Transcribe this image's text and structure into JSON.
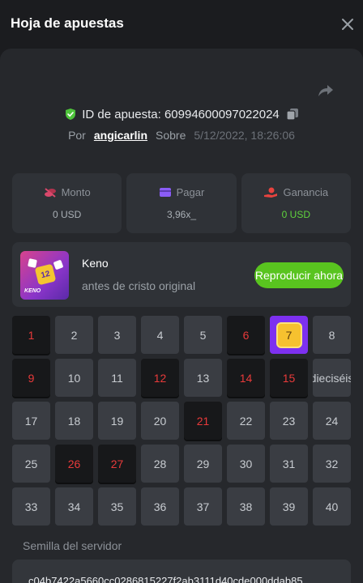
{
  "header": {
    "title": "Hoja de apuestas"
  },
  "bet": {
    "id_label": "ID de apuesta: 60994600097022024",
    "by_label": "Por",
    "user": "angicarlin",
    "on_label": "Sobre",
    "date": "5/12/2022, 18:26:06"
  },
  "stats": [
    {
      "label": "Monto",
      "value": "0 USD",
      "icon": "coins-icon",
      "color": "#d9486b"
    },
    {
      "label": "Pagar",
      "value": "3,96x_",
      "icon": "card-icon",
      "color": "#8a5cf6"
    },
    {
      "label": "Ganancia",
      "value": "0 USD",
      "icon": "hand-coin-icon",
      "color": "#e8433f"
    }
  ],
  "game": {
    "name": "Keno",
    "description": "antes de cristo original",
    "play_label": "Reproducir ahora",
    "thumb_label": "KENO",
    "thumb_tile": "12"
  },
  "grid": {
    "numbers": [
      "1",
      "2",
      "3",
      "4",
      "5",
      "6",
      "7",
      "8",
      "9",
      "10",
      "11",
      "12",
      "13",
      "14",
      "15",
      "dieciséis",
      "17",
      "18",
      "19",
      "20",
      "21",
      "22",
      "23",
      "24",
      "25",
      "26",
      "27",
      "28",
      "29",
      "30",
      "31",
      "32",
      "33",
      "34",
      "35",
      "36",
      "37",
      "38",
      "39",
      "40"
    ],
    "picked": [
      1,
      6,
      9,
      12,
      14,
      15,
      21,
      26,
      27
    ],
    "hit": [
      7
    ]
  },
  "seed": {
    "label": "Semilla del servidor",
    "value": "c04b7422a5660cc0286815227f2ab3111d40cde000ddab85"
  },
  "colors": {
    "accent_green": "#59c41f",
    "picked_red": "#e83a3a",
    "hit_purple": "#7d30f0",
    "verified_green": "#4ec33b"
  }
}
